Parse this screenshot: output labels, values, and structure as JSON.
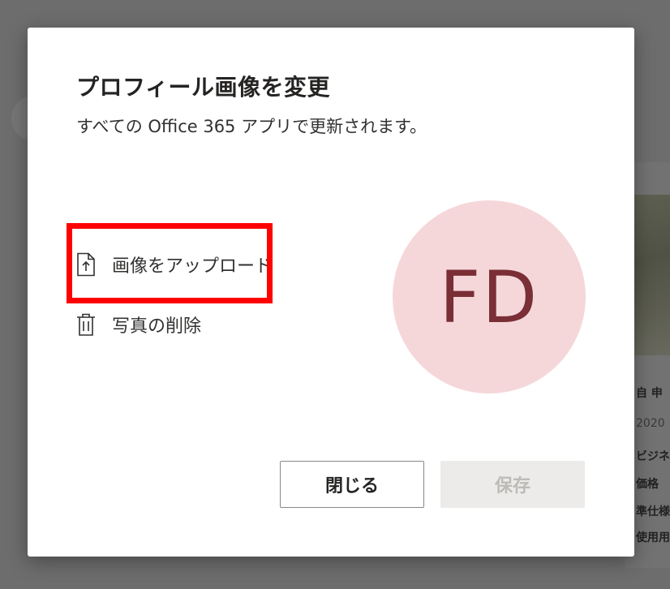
{
  "background": {
    "card_lines": [
      "自 申",
      "2020",
      "ビジネ",
      "価格",
      "準仕様",
      "使用用"
    ]
  },
  "dialog": {
    "title": "プロフィール画像を変更",
    "subtitle": "すべての Office 365 アプリで更新されます。",
    "actions": {
      "upload_label": "画像をアップロード",
      "upload_icon": "upload-file-icon",
      "delete_label": "写真の削除",
      "delete_icon": "trash-icon"
    },
    "avatar": {
      "initials": "FD",
      "background_color": "#f5d7da",
      "text_color": "#7a2e35"
    },
    "buttons": {
      "close_label": "閉じる",
      "save_label": "保存",
      "save_disabled": true
    }
  },
  "annotation": {
    "highlight_color": "#ff0000"
  }
}
